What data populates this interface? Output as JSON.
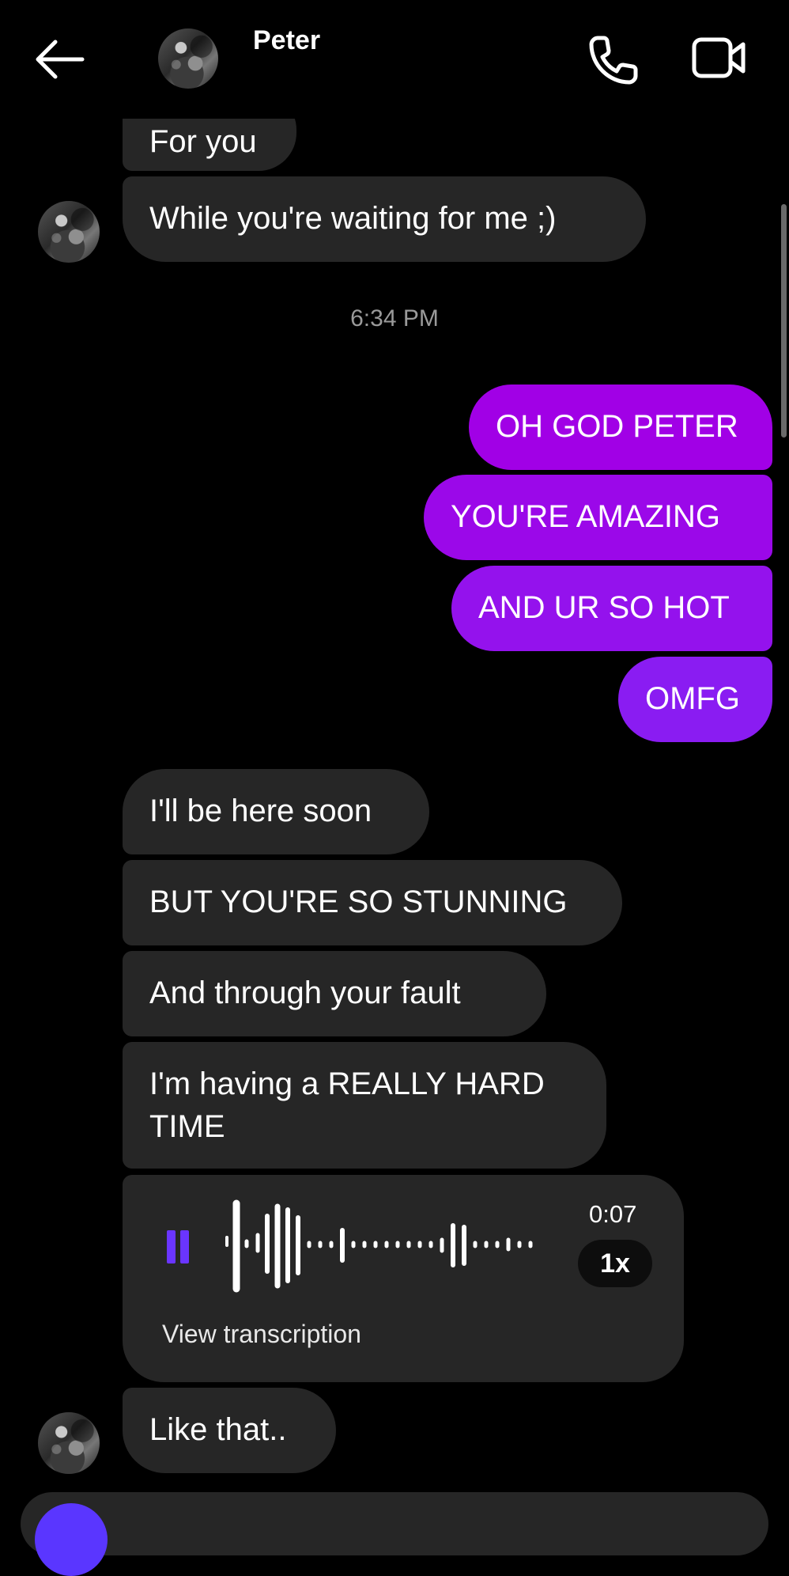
{
  "header": {
    "contact_name": "Peter"
  },
  "thread": {
    "messages_top": [
      {
        "text": "For you"
      },
      {
        "text": "While you're waiting for me ;)"
      }
    ],
    "timestamp": "6:34 PM",
    "messages_sent": [
      {
        "text": "OH GOD PETER"
      },
      {
        "text": "YOU'RE AMAZING"
      },
      {
        "text": "AND UR SO HOT"
      },
      {
        "text": "OMFG"
      }
    ],
    "messages_received": [
      {
        "text": "I'll be here soon"
      },
      {
        "text": "BUT YOU'RE SO STUNNING"
      },
      {
        "text": "And through your fault"
      },
      {
        "text": "I'm having a REALLY HARD TIME"
      }
    ],
    "voice_message": {
      "duration": "0:07",
      "speed": "1x",
      "transcription_label": "View transcription"
    },
    "last_message": {
      "text": "Like that.."
    }
  },
  "colors": {
    "background": "#000000",
    "received_bubble": "#262626",
    "sent_gradient_start": "#a100e6",
    "sent_gradient_end": "#8a1cf2",
    "accent": "#6a35ff"
  },
  "icons": [
    "arrow-left-icon",
    "phone-icon",
    "video-camera-icon",
    "pause-icon"
  ]
}
